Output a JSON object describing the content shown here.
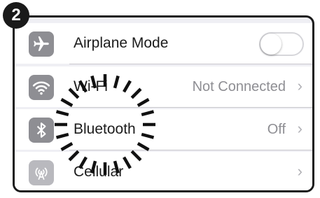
{
  "step_number": "2",
  "settings": {
    "rows": [
      {
        "label": "Airplane Mode",
        "icon": "airplane-icon",
        "control": "toggle",
        "toggle_on": false
      },
      {
        "label": "Wi-Fi",
        "icon": "wifi-icon",
        "value": "Not Connected",
        "chevron": "›"
      },
      {
        "label": "Bluetooth",
        "icon": "bluetooth-icon",
        "value": "Off",
        "chevron": "›"
      },
      {
        "label": "Cellular",
        "icon": "cellular-icon",
        "value": "",
        "chevron": "›"
      }
    ]
  },
  "colors": {
    "highlight": "#111111",
    "icon_background": "#8e8e93",
    "secondary_text": "#8e8e93"
  }
}
